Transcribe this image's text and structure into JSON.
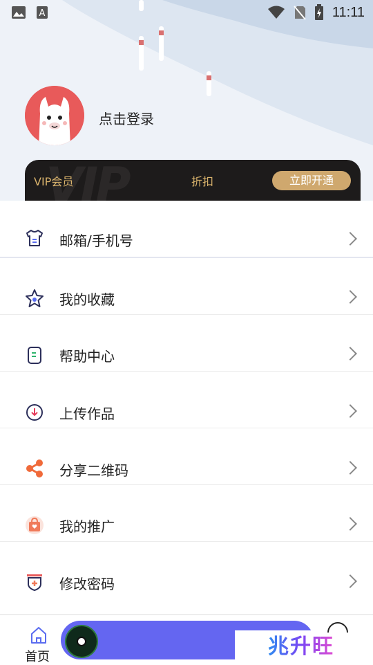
{
  "status_bar": {
    "time": "11:11",
    "left_icons": [
      "image-icon",
      "font-icon"
    ],
    "right_icons": [
      "wifi-icon",
      "no-sim-icon",
      "battery-charging-icon"
    ]
  },
  "profile": {
    "avatar_icon": "llama-avatar-icon",
    "login_text": "点击登录"
  },
  "vip": {
    "label": "VIP会员",
    "discount": "折扣",
    "button": "立即开通",
    "accent": "#d9b36c"
  },
  "menu": {
    "items": [
      {
        "label": "邮箱/手机号",
        "icon": "shirt-icon"
      },
      {
        "label": "我的收藏",
        "icon": "star-icon"
      },
      {
        "label": "帮助中心",
        "icon": "document-icon"
      },
      {
        "label": "上传作品",
        "icon": "download-circle-icon"
      },
      {
        "label": "分享二维码",
        "icon": "share-icon"
      },
      {
        "label": "我的推广",
        "icon": "shopping-bag-icon"
      },
      {
        "label": "修改密码",
        "icon": "shield-plus-icon"
      }
    ]
  },
  "bottom_nav": {
    "home_label": "首页",
    "player_color": "#6466f1",
    "watermark": "兆升旺"
  }
}
